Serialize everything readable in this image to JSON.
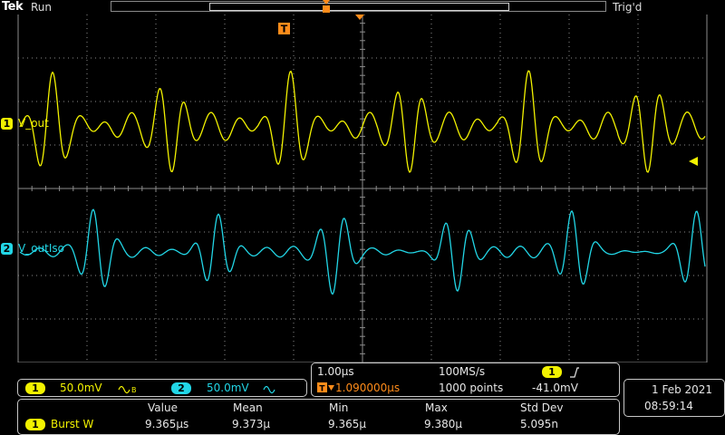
{
  "header": {
    "brand": "Tek",
    "run_state": "Run",
    "trigger_state": "Trig'd"
  },
  "trigger_marker": "T",
  "channels": [
    {
      "number": "1",
      "label": "V_out",
      "color": "#f2f200",
      "scale": "50.0mV"
    },
    {
      "number": "2",
      "label": "V_outIso",
      "color": "#22d6e6",
      "scale": "50.0mV"
    }
  ],
  "timebase": {
    "scale": "1.00µs",
    "sample_rate": "100MS/s",
    "trigger_position": "1.090000µs",
    "record_length": "1000 points",
    "trigger_source": "1",
    "trigger_level": "-41.0mV"
  },
  "datetime": {
    "date": "1 Feb 2021",
    "time": "08:59:14"
  },
  "measurements": {
    "headers": [
      "Value",
      "Mean",
      "Min",
      "Max",
      "Std Dev"
    ],
    "rows": [
      {
        "channel": "1",
        "name": "Burst W",
        "values": [
          "9.365µs",
          "9.373µ",
          "9.365µ",
          "9.380µ",
          "5.095n"
        ]
      }
    ]
  },
  "colors": {
    "ch1": "#f2f200",
    "ch2": "#22d6e6",
    "trigger": "#ff8c1a",
    "grid": "#8c8c8c"
  }
}
